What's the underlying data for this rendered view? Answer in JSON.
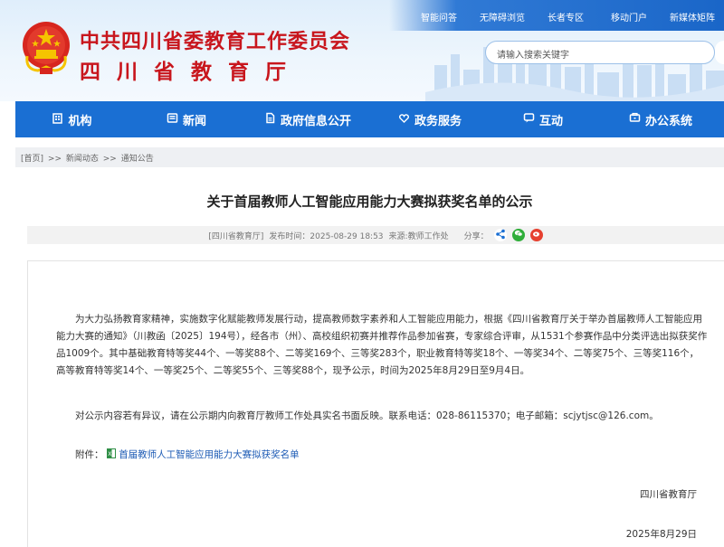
{
  "header": {
    "title": "中共四川省委教育工作委员会",
    "subtitle": "四川省教育厅",
    "top_links": [
      "智能问答",
      "无障碍浏览",
      "长者专区",
      "移动门户",
      "新媒体矩阵"
    ],
    "search_placeholder": "请输入搜索关键字"
  },
  "nav": {
    "items": [
      {
        "label": "机构",
        "icon": "building-icon"
      },
      {
        "label": "新闻",
        "icon": "newspaper-icon"
      },
      {
        "label": "政府信息公开",
        "icon": "document-icon"
      },
      {
        "label": "政务服务",
        "icon": "service-icon"
      },
      {
        "label": "互动",
        "icon": "chat-icon"
      },
      {
        "label": "办公系统",
        "icon": "office-icon"
      }
    ]
  },
  "breadcrumb": {
    "home": "[首页]",
    "sep": ">>",
    "level1": "新闻动态",
    "level2": "通知公告"
  },
  "article": {
    "title": "关于首届教师人工智能应用能力大赛拟获奖名单的公示",
    "meta_source_tag": "[四川省教育厅]",
    "meta_published": "发布时间：2025-08-29 18:53",
    "meta_origin": "来源:教师工作处",
    "meta_share": "分享：",
    "para1": "为大力弘扬教育家精神，实施数字化赋能教师发展行动，提高教师数字素养和人工智能应用能力，根据《四川省教育厅关于举办首届教师人工智能应用能力大赛的通知》（川教函〔2025〕194号），经各市（州）、高校组织初赛并推荐作品参加省赛，专家综合评审，从1531个参赛作品中分类评选出拟获奖作品1009个。其中基础教育特等奖44个、一等奖88个、二等奖169个、三等奖283个，职业教育特等奖18个、一等奖34个、二等奖75个、三等奖116个，高等教育特等奖14个、一等奖25个、二等奖55个、三等奖88个，现予公示，时间为2025年8月29日至9月4日。",
    "para2": "对公示内容若有异议，请在公示期内向教育厅教师工作处具实名书面反映。联系电话：028-86115370；电子邮箱：scjytjsc@126.com。",
    "attach_label": "附件：",
    "attach_link": "首届教师人工智能应用能力大赛拟获奖名单",
    "signature": "四川省教育厅",
    "date": "2025年8月29日"
  },
  "colors": {
    "nav_blue": "#1a6fd3",
    "title_red": "#c8161d",
    "link_blue": "#1d5bb5"
  }
}
